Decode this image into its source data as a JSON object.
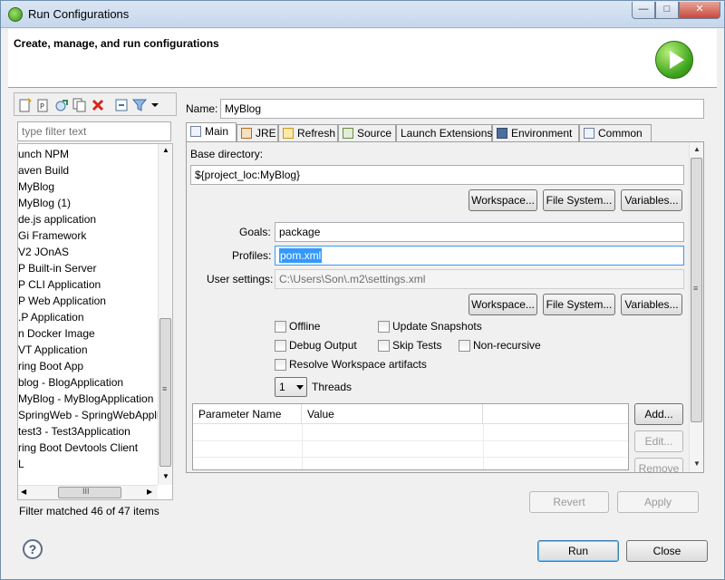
{
  "window": {
    "title": "Run Configurations",
    "controls": {
      "minimize": "—",
      "maximize": "□",
      "close": "✕"
    }
  },
  "header": {
    "title": "Create, manage, and run configurations"
  },
  "left": {
    "filter_placeholder": "type filter text",
    "tree_items": [
      "unch NPM",
      "aven Build",
      "MyBlog",
      "MyBlog (1)",
      "de.js application",
      "Gi Framework",
      "V2 JOnAS",
      "P Built-in Server",
      "P CLI Application",
      "P Web Application",
      ".P Application",
      "n Docker Image",
      "VT Application",
      "ring Boot App",
      "blog - BlogApplication",
      "MyBlog - MyBlogApplication",
      "SpringWeb - SpringWebApplication",
      "test3 - Test3Application",
      "ring Boot Devtools Client",
      "L"
    ],
    "selected_item": "MyBlog",
    "status": "Filter matched 46 of 47 items",
    "scroll": {
      "up": "▲",
      "down": "▼",
      "left": "◀",
      "right": "▶",
      "grip_h": "III",
      "grip_v": "≡"
    }
  },
  "right": {
    "name_label": "Name:",
    "name_value": "MyBlog",
    "tabs": [
      "Main",
      "JRE",
      "Refresh",
      "Source",
      "Launch Extensions",
      "Environment",
      "Common"
    ],
    "base_dir_label": "Base directory:",
    "base_dir_value": "${project_loc:MyBlog}",
    "btn_workspace": "Workspace...",
    "btn_filesystem": "File System...",
    "btn_variables": "Variables...",
    "goals_label": "Goals:",
    "goals_value": "package",
    "profiles_label": "Profiles:",
    "profiles_value": "pom.xml",
    "user_settings_label": "User settings:",
    "user_settings_value": "C:\\Users\\Son\\.m2\\settings.xml",
    "cb_offline": "Offline",
    "cb_update_snapshots": "Update Snapshots",
    "cb_debug_output": "Debug Output",
    "cb_skip_tests": "Skip Tests",
    "cb_non_recursive": "Non-recursive",
    "cb_resolve_workspace": "Resolve Workspace artifacts",
    "threads_value": "1",
    "threads_label": "Threads",
    "table_headers": [
      "Parameter Name",
      "Value"
    ],
    "btn_add": "Add...",
    "btn_edit": "Edit...",
    "btn_remove": "Remove",
    "btn_revert": "Revert",
    "btn_apply": "Apply"
  },
  "footer": {
    "btn_run": "Run",
    "btn_close": "Close",
    "help": "?"
  },
  "colors": {
    "accent": "#3399ff",
    "run_green": "#3fa41d",
    "title_bar": "#c6d7ec"
  }
}
